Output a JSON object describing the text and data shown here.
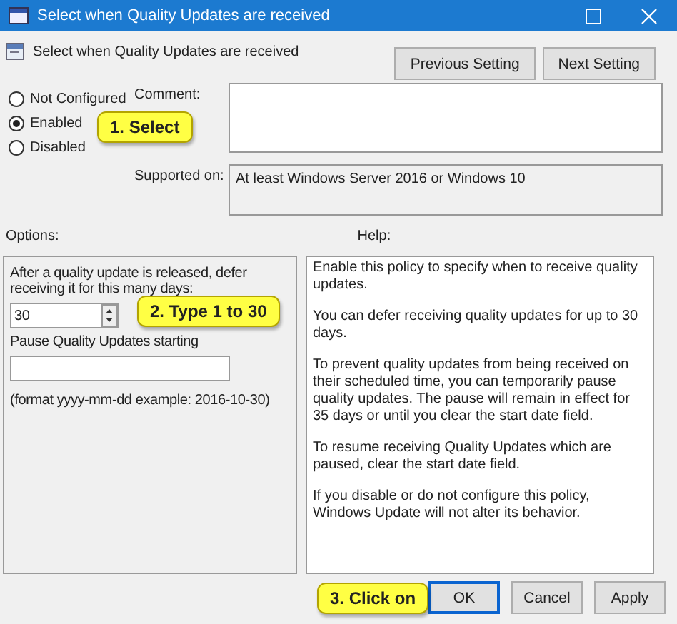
{
  "window": {
    "title": "Select when Quality Updates are received"
  },
  "header": {
    "title": "Select when Quality Updates are received",
    "buttons": [
      {
        "label": "Previous Setting"
      },
      {
        "label": "Next Setting"
      }
    ]
  },
  "state_options": [
    {
      "label": "Not Configured",
      "selected": false
    },
    {
      "label": "Enabled",
      "selected": true
    },
    {
      "label": "Disabled",
      "selected": false
    }
  ],
  "comment": {
    "label": "Comment:"
  },
  "supported_on": {
    "label": "Supported on:",
    "value": "At least Windows Server 2016 or Windows 10"
  },
  "options": {
    "label": "Options:",
    "defer_label": "After a quality update is released, defer receiving it for this many days:",
    "defer_value": "30",
    "pause_label": "Pause Quality Updates starting",
    "format_hint": "(format yyyy-mm-dd example: 2016-10-30)"
  },
  "help": {
    "label": "Help:",
    "paragraphs": [
      "Enable this policy to specify when to receive quality updates.",
      "You can defer receiving quality updates for up to 30 days.",
      "To prevent quality updates from being received on their scheduled time, you can temporarily pause quality updates. The pause will remain in effect for 35 days or until you clear the start date field.",
      "To resume receiving Quality Updates which are paused, clear the start date field.",
      "If you disable or do not configure this policy, Windows Update will not alter its behavior."
    ]
  },
  "footer_buttons": [
    {
      "label": "OK",
      "selected": true
    },
    {
      "label": "Cancel",
      "selected": false
    },
    {
      "label": "Apply",
      "selected": false
    }
  ],
  "callouts": [
    "1. Select",
    "2. Type 1 to 30",
    "3. Click on"
  ]
}
